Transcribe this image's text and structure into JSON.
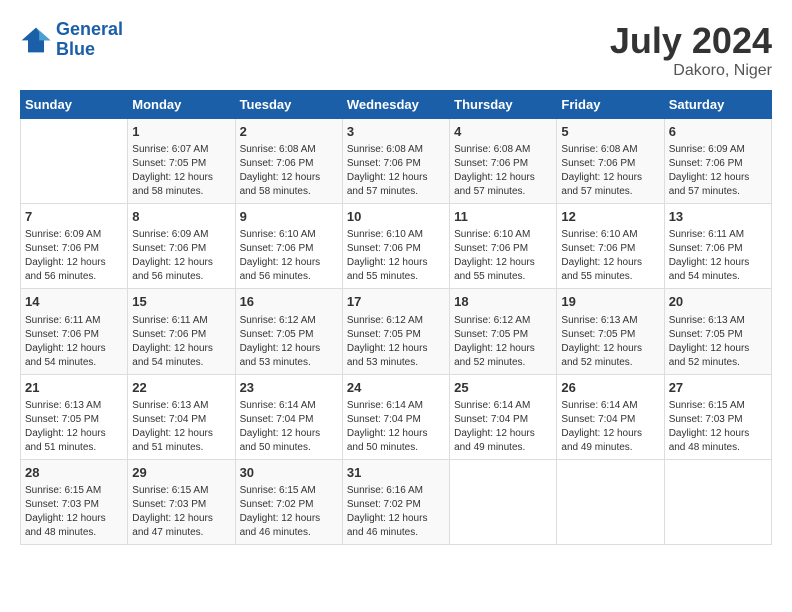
{
  "logo": {
    "name_part1": "General",
    "name_part2": "Blue"
  },
  "title": "July 2024",
  "subtitle": "Dakoro, Niger",
  "days_of_week": [
    "Sunday",
    "Monday",
    "Tuesday",
    "Wednesday",
    "Thursday",
    "Friday",
    "Saturday"
  ],
  "weeks": [
    [
      {
        "day": "",
        "info": ""
      },
      {
        "day": "1",
        "info": "Sunrise: 6:07 AM\nSunset: 7:05 PM\nDaylight: 12 hours\nand 58 minutes."
      },
      {
        "day": "2",
        "info": "Sunrise: 6:08 AM\nSunset: 7:06 PM\nDaylight: 12 hours\nand 58 minutes."
      },
      {
        "day": "3",
        "info": "Sunrise: 6:08 AM\nSunset: 7:06 PM\nDaylight: 12 hours\nand 57 minutes."
      },
      {
        "day": "4",
        "info": "Sunrise: 6:08 AM\nSunset: 7:06 PM\nDaylight: 12 hours\nand 57 minutes."
      },
      {
        "day": "5",
        "info": "Sunrise: 6:08 AM\nSunset: 7:06 PM\nDaylight: 12 hours\nand 57 minutes."
      },
      {
        "day": "6",
        "info": "Sunrise: 6:09 AM\nSunset: 7:06 PM\nDaylight: 12 hours\nand 57 minutes."
      }
    ],
    [
      {
        "day": "7",
        "info": "Sunrise: 6:09 AM\nSunset: 7:06 PM\nDaylight: 12 hours\nand 56 minutes."
      },
      {
        "day": "8",
        "info": "Sunrise: 6:09 AM\nSunset: 7:06 PM\nDaylight: 12 hours\nand 56 minutes."
      },
      {
        "day": "9",
        "info": "Sunrise: 6:10 AM\nSunset: 7:06 PM\nDaylight: 12 hours\nand 56 minutes."
      },
      {
        "day": "10",
        "info": "Sunrise: 6:10 AM\nSunset: 7:06 PM\nDaylight: 12 hours\nand 55 minutes."
      },
      {
        "day": "11",
        "info": "Sunrise: 6:10 AM\nSunset: 7:06 PM\nDaylight: 12 hours\nand 55 minutes."
      },
      {
        "day": "12",
        "info": "Sunrise: 6:10 AM\nSunset: 7:06 PM\nDaylight: 12 hours\nand 55 minutes."
      },
      {
        "day": "13",
        "info": "Sunrise: 6:11 AM\nSunset: 7:06 PM\nDaylight: 12 hours\nand 54 minutes."
      }
    ],
    [
      {
        "day": "14",
        "info": "Sunrise: 6:11 AM\nSunset: 7:06 PM\nDaylight: 12 hours\nand 54 minutes."
      },
      {
        "day": "15",
        "info": "Sunrise: 6:11 AM\nSunset: 7:06 PM\nDaylight: 12 hours\nand 54 minutes."
      },
      {
        "day": "16",
        "info": "Sunrise: 6:12 AM\nSunset: 7:05 PM\nDaylight: 12 hours\nand 53 minutes."
      },
      {
        "day": "17",
        "info": "Sunrise: 6:12 AM\nSunset: 7:05 PM\nDaylight: 12 hours\nand 53 minutes."
      },
      {
        "day": "18",
        "info": "Sunrise: 6:12 AM\nSunset: 7:05 PM\nDaylight: 12 hours\nand 52 minutes."
      },
      {
        "day": "19",
        "info": "Sunrise: 6:13 AM\nSunset: 7:05 PM\nDaylight: 12 hours\nand 52 minutes."
      },
      {
        "day": "20",
        "info": "Sunrise: 6:13 AM\nSunset: 7:05 PM\nDaylight: 12 hours\nand 52 minutes."
      }
    ],
    [
      {
        "day": "21",
        "info": "Sunrise: 6:13 AM\nSunset: 7:05 PM\nDaylight: 12 hours\nand 51 minutes."
      },
      {
        "day": "22",
        "info": "Sunrise: 6:13 AM\nSunset: 7:04 PM\nDaylight: 12 hours\nand 51 minutes."
      },
      {
        "day": "23",
        "info": "Sunrise: 6:14 AM\nSunset: 7:04 PM\nDaylight: 12 hours\nand 50 minutes."
      },
      {
        "day": "24",
        "info": "Sunrise: 6:14 AM\nSunset: 7:04 PM\nDaylight: 12 hours\nand 50 minutes."
      },
      {
        "day": "25",
        "info": "Sunrise: 6:14 AM\nSunset: 7:04 PM\nDaylight: 12 hours\nand 49 minutes."
      },
      {
        "day": "26",
        "info": "Sunrise: 6:14 AM\nSunset: 7:04 PM\nDaylight: 12 hours\nand 49 minutes."
      },
      {
        "day": "27",
        "info": "Sunrise: 6:15 AM\nSunset: 7:03 PM\nDaylight: 12 hours\nand 48 minutes."
      }
    ],
    [
      {
        "day": "28",
        "info": "Sunrise: 6:15 AM\nSunset: 7:03 PM\nDaylight: 12 hours\nand 48 minutes."
      },
      {
        "day": "29",
        "info": "Sunrise: 6:15 AM\nSunset: 7:03 PM\nDaylight: 12 hours\nand 47 minutes."
      },
      {
        "day": "30",
        "info": "Sunrise: 6:15 AM\nSunset: 7:02 PM\nDaylight: 12 hours\nand 46 minutes."
      },
      {
        "day": "31",
        "info": "Sunrise: 6:16 AM\nSunset: 7:02 PM\nDaylight: 12 hours\nand 46 minutes."
      },
      {
        "day": "",
        "info": ""
      },
      {
        "day": "",
        "info": ""
      },
      {
        "day": "",
        "info": ""
      }
    ]
  ]
}
